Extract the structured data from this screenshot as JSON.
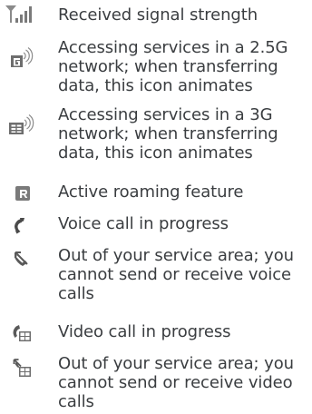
{
  "icon_legend": {
    "items": [
      {
        "icon": "signal-strength-icon",
        "description": "Received signal strength"
      },
      {
        "icon": "network-2-5g-icon",
        "description": "Accessing services in a 2.5G network; when transferring data, this icon animates"
      },
      {
        "icon": "network-3g-icon",
        "description": "Accessing services in a 3G network; when transferring data, this icon animates"
      },
      {
        "icon": "roaming-icon",
        "description": "Active roaming feature"
      },
      {
        "icon": "voice-call-icon",
        "description": "Voice call in progress"
      },
      {
        "icon": "no-voice-service-icon",
        "description": "Out of your service area; you cannot send or receive voice calls"
      },
      {
        "icon": "video-call-icon",
        "description": "Video call in progress"
      },
      {
        "icon": "no-video-service-icon",
        "description": "Out of your service area; you cannot send or receive video calls"
      }
    ]
  }
}
